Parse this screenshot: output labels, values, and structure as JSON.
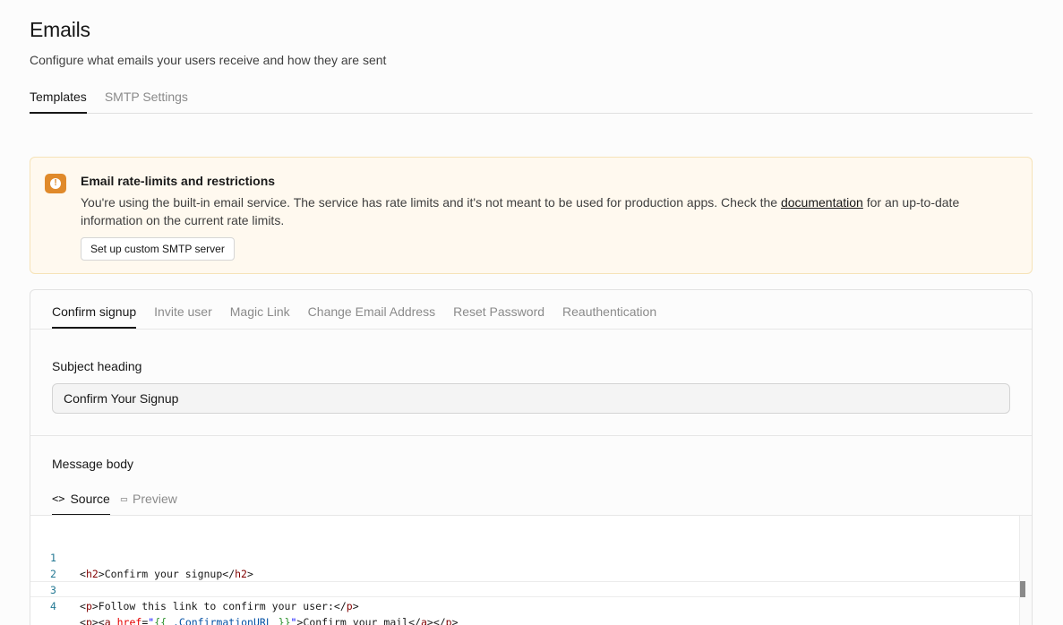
{
  "page": {
    "title": "Emails",
    "subtitle": "Configure what emails your users receive and how they are sent"
  },
  "main_tabs": [
    {
      "label": "Templates",
      "active": true
    },
    {
      "label": "SMTP Settings",
      "active": false
    }
  ],
  "alert": {
    "icon": "alert-circle-icon",
    "title": "Email rate-limits and restrictions",
    "text_before": "You're using the built-in email service. The service has rate limits and it's not meant to be used for production apps. Check the ",
    "link": "documentation",
    "text_after": " for an up-to-date information on the current rate limits.",
    "button": "Set up custom SMTP server",
    "accent_color": "#e08a2b"
  },
  "template_tabs": [
    {
      "label": "Confirm signup",
      "active": true
    },
    {
      "label": "Invite user",
      "active": false
    },
    {
      "label": "Magic Link",
      "active": false
    },
    {
      "label": "Change Email Address",
      "active": false
    },
    {
      "label": "Reset Password",
      "active": false
    },
    {
      "label": "Reauthentication",
      "active": false
    }
  ],
  "subject": {
    "label": "Subject heading",
    "value": "Confirm Your Signup"
  },
  "message_body": {
    "label": "Message body",
    "view_tabs": [
      {
        "label": "Source",
        "icon": "code-icon",
        "glyph": "<>",
        "active": true
      },
      {
        "label": "Preview",
        "icon": "monitor-icon",
        "glyph": "▭",
        "active": false
      }
    ]
  },
  "editor": {
    "lines": [
      {
        "number": "1",
        "text": "<h2>Confirm your signup</h2>"
      },
      {
        "number": "2",
        "text": ""
      },
      {
        "number": "3",
        "text": "<p>Follow this link to confirm your user:</p>"
      },
      {
        "number": "4",
        "text": "<p><a href=\"{{ .ConfirmationURL }}\">Confirm your mail</a></p>"
      }
    ]
  }
}
